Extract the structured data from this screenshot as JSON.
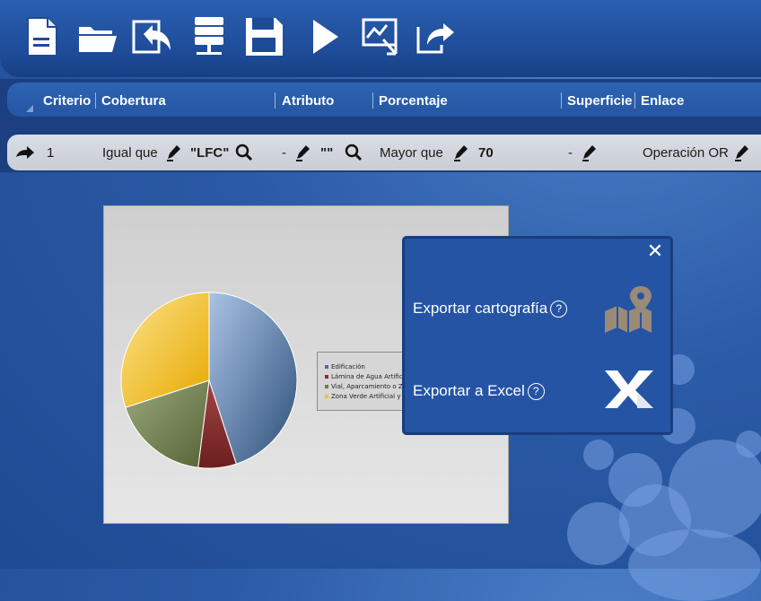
{
  "toolbar": {
    "buttons": [
      {
        "name": "new-document-icon"
      },
      {
        "name": "open-folder-icon"
      },
      {
        "name": "undo-icon"
      },
      {
        "name": "server-icon"
      },
      {
        "name": "save-icon"
      },
      {
        "name": "play-icon"
      },
      {
        "name": "chart-export-icon"
      },
      {
        "name": "share-export-icon"
      }
    ]
  },
  "criteria": {
    "headers": {
      "criterio": "Criterio",
      "cobertura": "Cobertura",
      "atributo": "Atributo",
      "porcentaje": "Porcentaje",
      "superficie": "Superficie",
      "enlace": "Enlace"
    },
    "row": {
      "index": "1",
      "cobertura_op": "Igual que",
      "cobertura_val": "\"LFC\"",
      "atributo_op": "-",
      "atributo_val": "\"\"",
      "porcentaje_op": "Mayor que",
      "porcentaje_val": "70",
      "superficie_op": "-",
      "enlace_op": "Operación OR"
    }
  },
  "chart_data": {
    "type": "pie",
    "title": "",
    "categories": [
      "Edificación",
      "Lámina de Agua Artificial",
      "Vial, Aparcamiento o Zona",
      "Zona Verde Artificial y Arbolado"
    ],
    "values": [
      45,
      7,
      18,
      30
    ],
    "colors": [
      "#4a6f9c",
      "#8b2e2e",
      "#6b7d45",
      "#f2c12e"
    ],
    "legend_position": "right"
  },
  "export": {
    "close_label": "✕",
    "cartografia_label": "Exportar cartografía",
    "excel_label": "Exportar a Excel",
    "help_label": "?"
  }
}
